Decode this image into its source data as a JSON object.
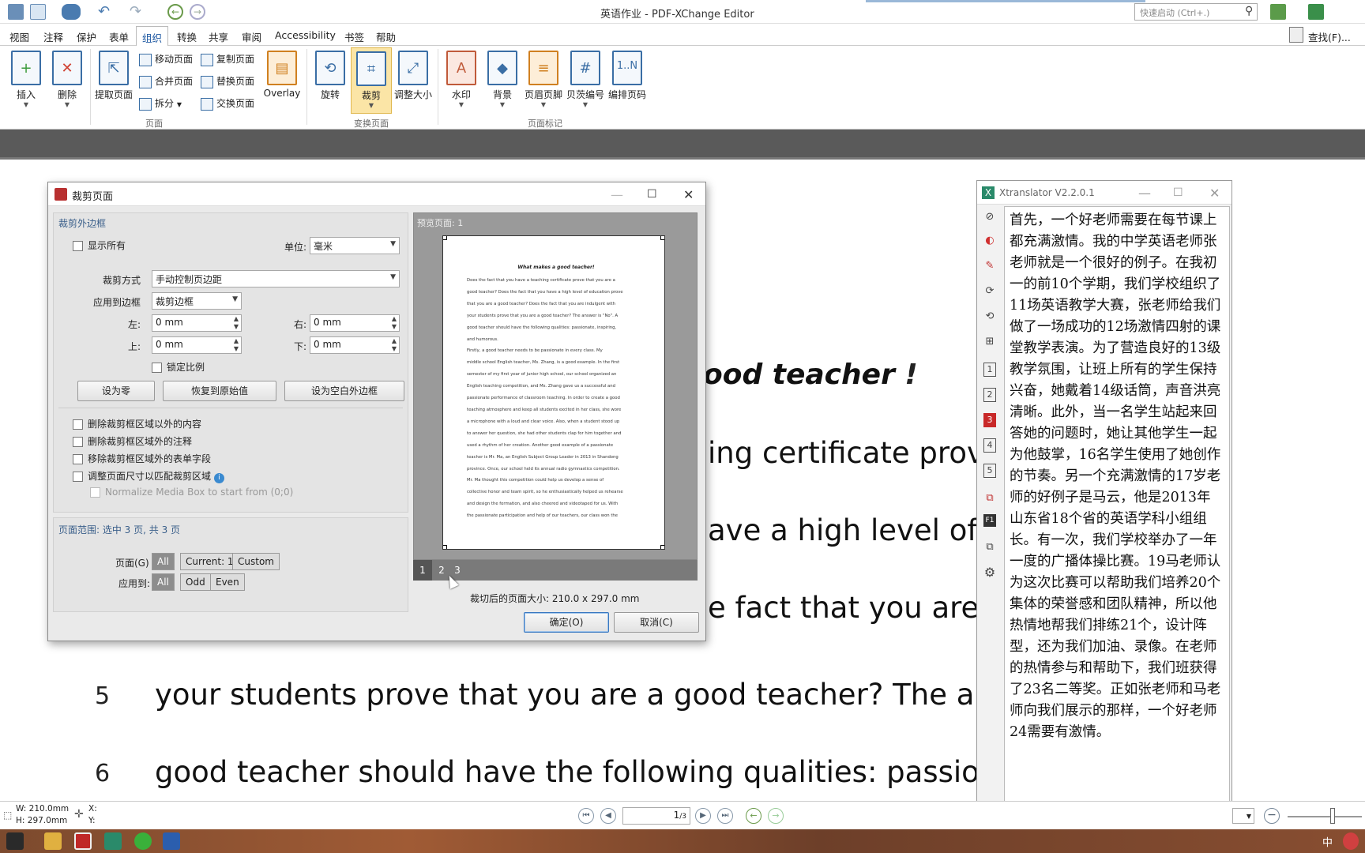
{
  "window": {
    "title": "英语作业 - PDF-XChange Editor"
  },
  "quick_search": {
    "placeholder": "快速启动 (Ctrl+.)"
  },
  "find_label": "查找(F)...",
  "menu": [
    "视图",
    "注释",
    "保护",
    "表单",
    "组织",
    "转换",
    "共享",
    "审阅",
    "Accessibility",
    "书签",
    "帮助"
  ],
  "menu_active": "组织",
  "ribbon": {
    "insert": "插入",
    "delete": "删除",
    "extract": "提取页面",
    "move": "移动页面",
    "merge": "合并页面",
    "split": "拆分",
    "copy": "复制页面",
    "replace": "替换页面",
    "swap": "交换页面",
    "overlay": "Overlay",
    "rotate": "旋转",
    "crop": "裁剪",
    "resize": "调整大小",
    "watermark": "水印",
    "background": "背景",
    "header_footer": "页眉页脚",
    "bates": "贝茨编号",
    "page_numbers": "编排页码",
    "group_pages": "页面",
    "group_transform": "变换页面",
    "group_marks": "页面标记"
  },
  "document": {
    "title_fragment": "ood teacher",
    "lines": [
      "ing certificate prov",
      "ave a high level of e",
      "e fact that you are",
      "your students prove that you are a good teacher? The an",
      "good teacher should have the following qualities: passio"
    ],
    "line_numbers": [
      "5",
      "6"
    ]
  },
  "crop_dialog": {
    "title": "裁剪页面",
    "section_margins": "裁剪外边框",
    "show_all": "显示所有",
    "unit_label": "单位:",
    "unit_value": "毫米",
    "crop_mode_label": "裁剪方式",
    "crop_mode_value": "手动控制页边距",
    "apply_box_label": "应用到边框",
    "apply_box_value": "裁剪边框",
    "left_label": "左:",
    "right_label": "右:",
    "top_label": "上:",
    "bottom_label": "下:",
    "left_value": "0 mm",
    "right_value": "0 mm",
    "top_value": "0 mm",
    "bottom_value": "0 mm",
    "lock_ratio": "锁定比例",
    "btn_zero": "设为零",
    "btn_restore": "恢复到原始值",
    "btn_blank": "设为空白外边框",
    "opt1": "删除裁剪框区域以外的内容",
    "opt2": "删除裁剪框区域外的注释",
    "opt3": "移除裁剪框区域外的表单字段",
    "opt4": "调整页面尺寸以匹配裁剪区域",
    "opt5": "Normalize Media Box to start from (0;0)",
    "page_range": "页面范围: 选中 3 页, 共 3 页",
    "pages_label": "页面(G)",
    "pages_all": "All",
    "pages_current": "Current: 1",
    "pages_custom": "Custom",
    "apply_to_label": "应用到:",
    "apply_all": "All",
    "apply_odd": "Odd",
    "apply_even": "Even",
    "preview_label": "预览页面: 1",
    "preview_tabs": [
      "1",
      "2",
      "3"
    ],
    "preview_title": "What makes a good teacher!",
    "preview_lines": [
      "Does the fact that you have a teaching certificate prove that you are a",
      "good teacher? Does the fact that you have a high level of education prove",
      "that you are a good teacher? Does the fact that you are indulgent with",
      "your students prove that you are a good teacher? The answer is \"No\". A",
      "good teacher should have the following qualities: passionate, inspiring,",
      "and humorous.",
      "Firstly, a good teacher needs to be passionate in every class. My",
      "middle school English teacher, Ms. Zhang, is a good example. In the first",
      "semester of my first year of junior high school, our school organized an",
      "English teaching competition, and Ms. Zhang gave us a successful and",
      "passionate performance of classroom teaching. In order to create a good",
      "teaching atmosphere and keep all students excited in her class, she wore",
      "a microphone with a loud and clear voice. Also, when a student stood up",
      "to answer her question, she had other students clap for him together and",
      "used a rhythm of her creation. Another good example of a passionate",
      "teacher is Mr. Ma, an English Subject Group Leader in 2013 in Shandong",
      "province. Once, our school held its annual radio gymnastics competition.",
      "Mr. Ma thought this competition could help us develop a sense of",
      "collective honor and team spirit, so he enthusiastically helped us rehearse",
      "and design the formation, and also cheered and videotaped for us. With",
      "the passionate participation and help of our teachers, our class won the"
    ],
    "page_size": "裁切后的页面大小: 210.0 x 297.0 mm",
    "ok": "确定(O)",
    "cancel": "取消(C)"
  },
  "xtranslator": {
    "title": "Xtranslator V2.2.0.1",
    "side_numbers": [
      "1",
      "2",
      "3",
      "4",
      "5"
    ],
    "text": "首先，一个好老师需要在每节课上都充满激情。我的中学英语老师张老师就是一个很好的例子。在我初一的前10个学期，我们学校组织了11场英语教学大赛，张老师给我们做了一场成功的12场激情四射的课堂教学表演。为了营造良好的13级教学氛围，让班上所有的学生保持兴奋，她戴着14级话筒，声音洪亮清晰。此外，当一名学生站起来回答她的问题时，她让其他学生一起为他鼓掌，16名学生使用了她创作的节奏。另一个充满激情的17岁老师的好例子是马云，他是2013年山东省18个省的英语学科小组组长。有一次，我们学校举办了一年一度的广播体操比赛。19马老师认为这次比赛可以帮助我们培养20个集体的荣誉感和团队精神，所以他热情地帮我们排练21个，设计阵型，还为我们加油、录像。在老师的热情参与和帮助下，我们班获得了23名二等奖。正如张老师和马老师向我们展示的那样，一个好老师24需要有激情。"
  },
  "statusbar": {
    "width": "W: 210.0mm",
    "height": "H: 297.0mm",
    "x": "X:",
    "y": "Y:",
    "page_input": "1",
    "page_total": "/3"
  },
  "taskbar": {
    "ime": "中"
  },
  "colors": {
    "accent": "#3a6ea5",
    "selected": "#fbe5a6",
    "dark_band": "#5a5a5a"
  }
}
